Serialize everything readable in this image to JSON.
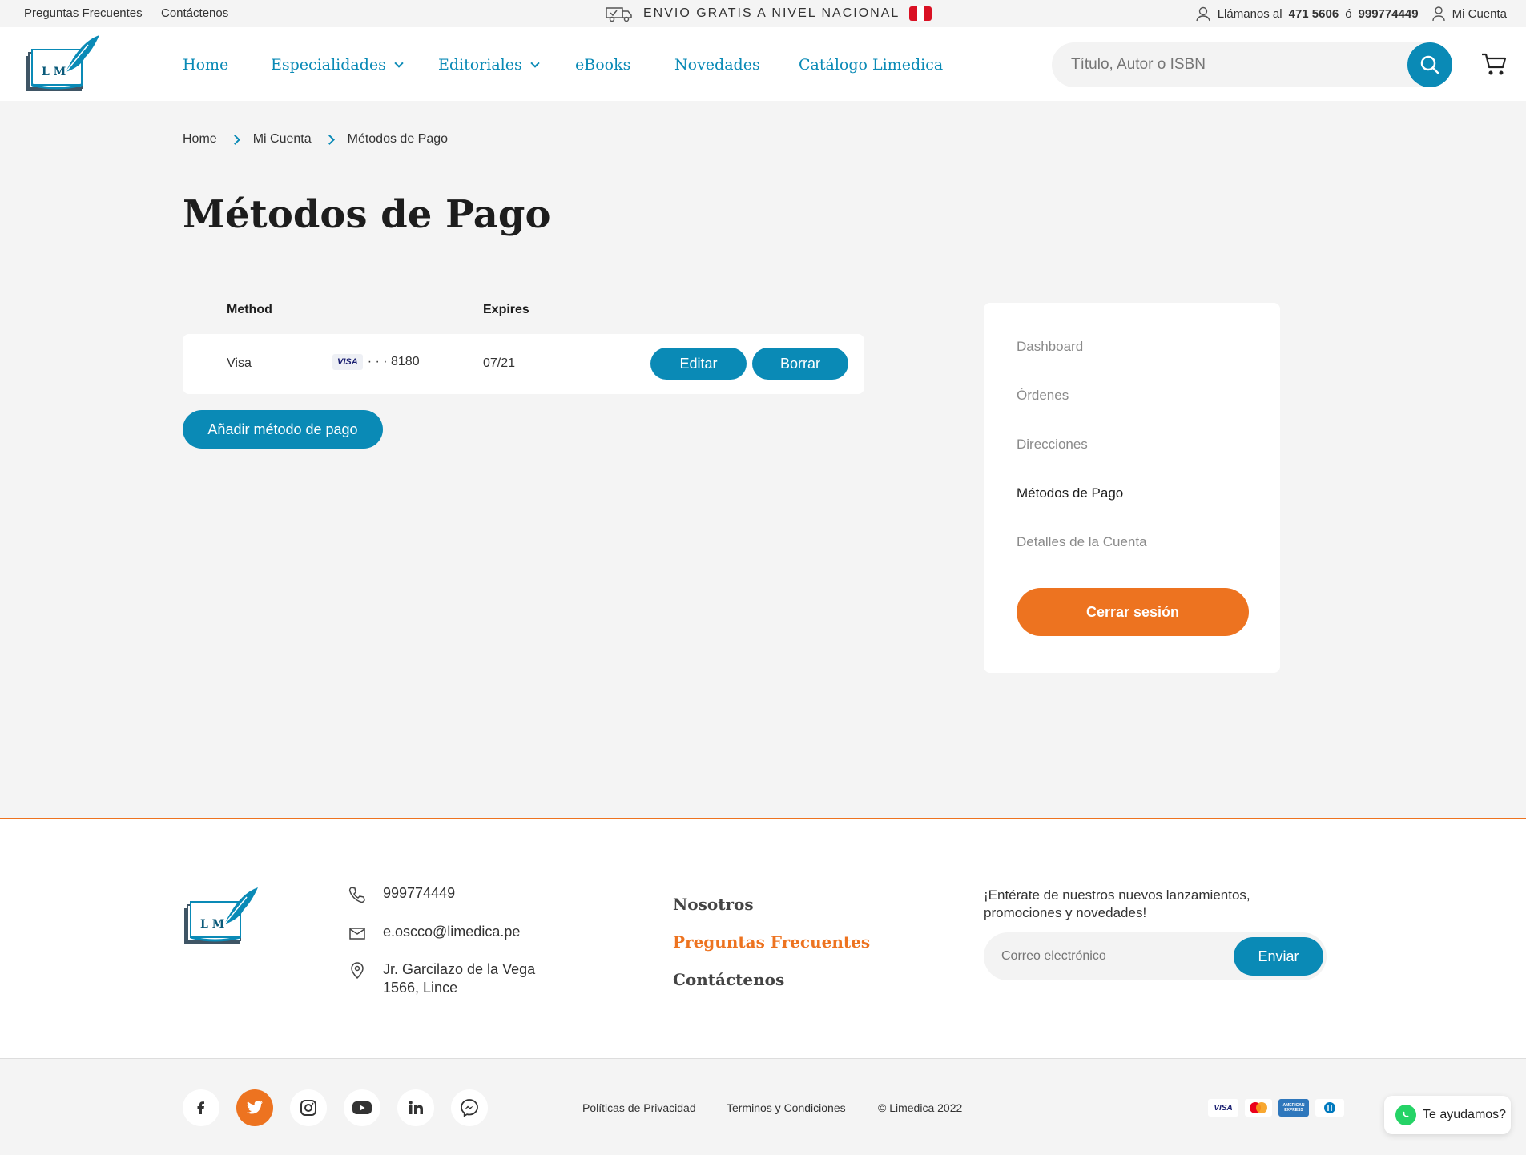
{
  "topbar": {
    "faq": "Preguntas Frecuentes",
    "contact": "Contáctenos",
    "shipping": "ENVIO GRATIS A NIVEL NACIONAL",
    "call_label": "Llámanos al",
    "phone1": "471 5606",
    "or": "ó",
    "phone2": "999774449",
    "account": "Mi Cuenta"
  },
  "brand": {
    "logo_text": "L M",
    "colors": {
      "primary": "#0a8ab6",
      "accent": "#ed7320"
    }
  },
  "nav": {
    "items": [
      {
        "label": "Home"
      },
      {
        "label": "Especialidades",
        "dropdown": true
      },
      {
        "label": "Editoriales",
        "dropdown": true
      },
      {
        "label": "eBooks"
      },
      {
        "label": "Novedades"
      },
      {
        "label": "Catálogo Limedica"
      }
    ]
  },
  "search": {
    "placeholder": "Título, Autor o ISBN"
  },
  "breadcrumb": [
    "Home",
    "Mi Cuenta",
    "Métodos de Pago"
  ],
  "page": {
    "title": "Métodos de Pago"
  },
  "table": {
    "headers": {
      "method": "Method",
      "expires": "Expires"
    },
    "rows": [
      {
        "method": "Visa",
        "card_brand": "VISA",
        "masked": "· · · 8180",
        "expires": "07/21",
        "edit": "Editar",
        "delete": "Borrar"
      }
    ],
    "add_button": "Añadir método de pago"
  },
  "account_menu": {
    "items": [
      "Dashboard",
      "Órdenes",
      "Direcciones",
      "Métodos de Pago",
      "Detalles de la Cuenta"
    ],
    "active": "Métodos de Pago",
    "logout": "Cerrar sesión"
  },
  "footer": {
    "phone": "999774449",
    "email": "e.oscco@limedica.pe",
    "address_line1": "Jr. Garcilazo de la Vega",
    "address_line2": "1566, Lince",
    "links": [
      "Nosotros",
      "Preguntas Frecuentes",
      "Contáctenos"
    ],
    "newsletter_text": "¡Entérate de nuestros nuevos lanzamientos, promociones y novedades!",
    "newsletter_placeholder": "Correo electrónico",
    "newsletter_button": "Enviar",
    "social": [
      "facebook-icon",
      "twitter-icon",
      "instagram-icon",
      "youtube-icon",
      "linkedin-icon",
      "messenger-icon"
    ],
    "legal": [
      "Políticas de Privacidad",
      "Terminos y Condiciones",
      "© Limedica 2022"
    ],
    "payments": [
      "VISA",
      "mastercard",
      "AMERICAN EXPRESS",
      "diners"
    ],
    "help": "Te ayudamos?"
  }
}
